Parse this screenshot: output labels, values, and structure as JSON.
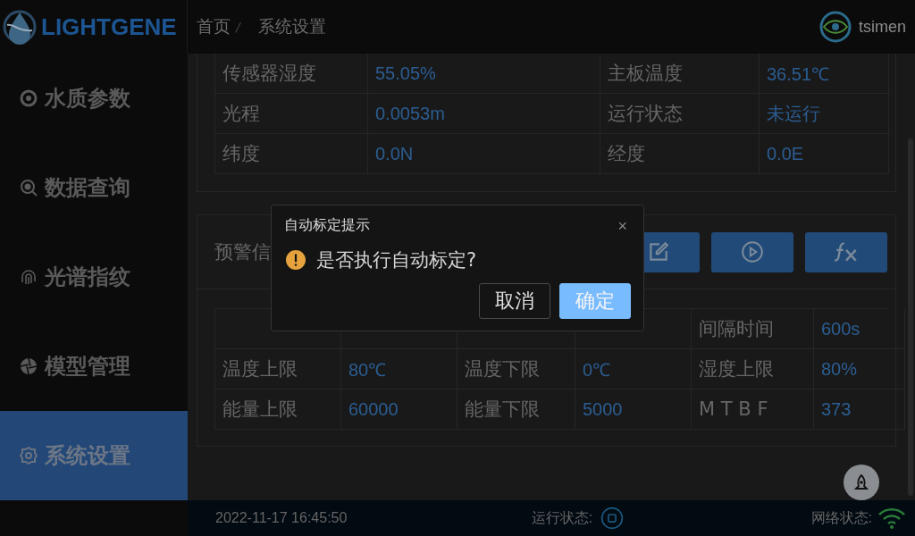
{
  "header": {
    "logo_text": "LIGHTGENE",
    "breadcrumb": [
      "首页",
      "/",
      "系统设置"
    ],
    "username": "tsimen"
  },
  "sidebar": {
    "items": [
      {
        "label": "水质参数",
        "selected": false
      },
      {
        "label": "数据查询",
        "selected": false
      },
      {
        "label": "光谱指纹",
        "selected": false
      },
      {
        "label": "模型管理",
        "selected": false
      },
      {
        "label": "系统设置",
        "selected": true
      }
    ]
  },
  "sensor_panel": {
    "rows": [
      [
        {
          "label": "传感器湿度",
          "value": "55.05%"
        },
        {
          "label": "主板温度",
          "value": "36.51℃"
        }
      ],
      [
        {
          "label": "光程",
          "value": "0.0053m"
        },
        {
          "label": "运行状态",
          "value": "未运行"
        }
      ],
      [
        {
          "label": "纬度",
          "value": "0.0N"
        },
        {
          "label": "经度",
          "value": "0.0E"
        }
      ]
    ]
  },
  "alert_panel": {
    "title": "预警信",
    "rows": [
      [
        {},
        {},
        {
          "label": "间隔时间",
          "value": "600s"
        }
      ],
      [
        {
          "label": "温度上限",
          "value": "80℃"
        },
        {
          "label": "温度下限",
          "value": "0℃"
        },
        {
          "label": "湿度上限",
          "value": "80%"
        }
      ],
      [
        {
          "label": "能量上限",
          "value": "60000"
        },
        {
          "label": "能量下限",
          "value": "5000"
        },
        {
          "label": "M T B F",
          "value": "373"
        }
      ]
    ]
  },
  "dialog": {
    "title": "自动标定提示",
    "close": "×",
    "message": "是否执行自动标定?",
    "buttons": [
      {
        "label": "取消",
        "primary": false
      },
      {
        "label": "确定",
        "primary": true
      }
    ]
  },
  "status_bar": {
    "datetime": "2022-11-17 16:45:50",
    "run_label": "运行状态:",
    "network_label": "网络状态:"
  }
}
